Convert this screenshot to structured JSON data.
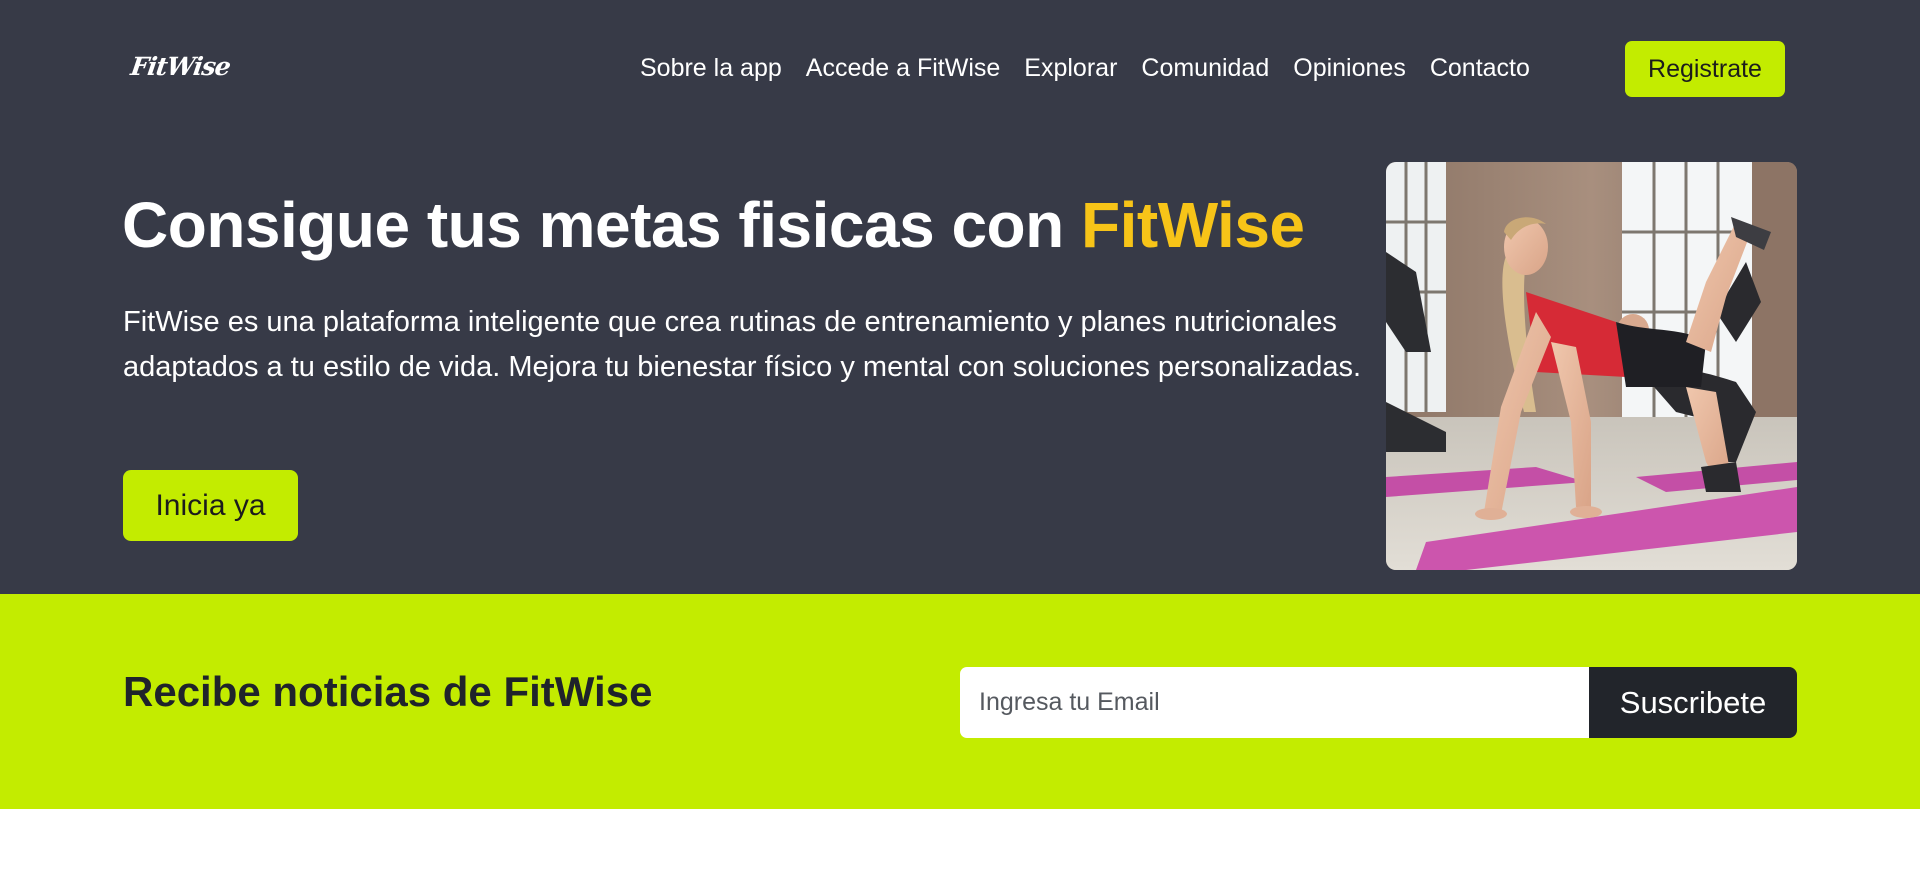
{
  "brand": {
    "logo": "FitWise",
    "accent_color": "#c3ec00",
    "highlight_color": "#f7c418",
    "dark_bg": "#373a47"
  },
  "nav": {
    "links": [
      "Sobre la app",
      "Accede a FitWise",
      "Explorar",
      "Comunidad",
      "Opiniones",
      "Contacto"
    ],
    "register_label": "Registrate"
  },
  "hero": {
    "title": "Consigue tus metas fisicas con",
    "title_highlight": "FitWise",
    "description": "FitWise es una plataforma inteligente que crea rutinas de entrenamiento y planes nutricionales adaptados a tu estilo de vida. Mejora tu bienestar físico y mental con soluciones personalizadas.",
    "cta_label": "Inicia ya"
  },
  "newsletter": {
    "title": "Recibe noticias de FitWise",
    "email_placeholder": "Ingresa tu Email",
    "subscribe_label": "Suscribete"
  }
}
